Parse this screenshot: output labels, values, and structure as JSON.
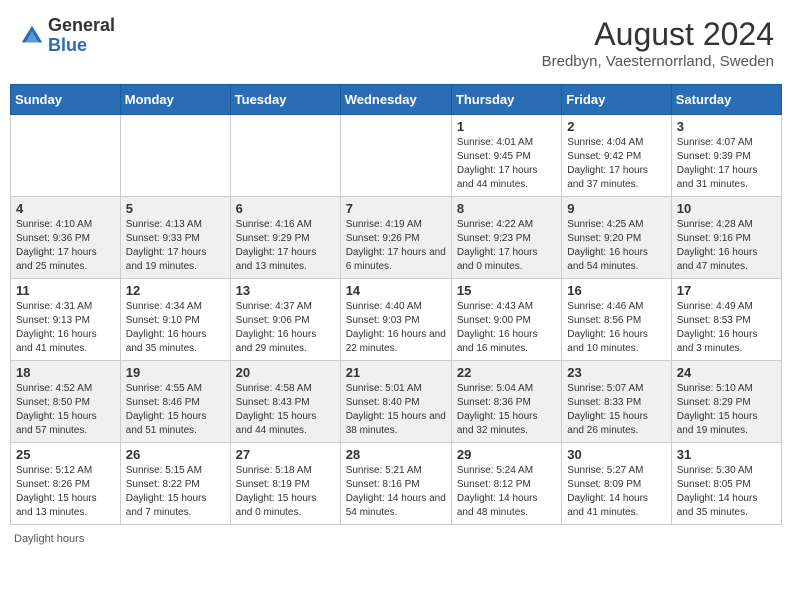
{
  "header": {
    "logo_general": "General",
    "logo_blue": "Blue",
    "month_year": "August 2024",
    "location": "Bredbyn, Vaesternorrland, Sweden"
  },
  "days_of_week": [
    "Sunday",
    "Monday",
    "Tuesday",
    "Wednesday",
    "Thursday",
    "Friday",
    "Saturday"
  ],
  "weeks": [
    [
      {
        "day": "",
        "sunrise": "",
        "sunset": "",
        "daylight": ""
      },
      {
        "day": "",
        "sunrise": "",
        "sunset": "",
        "daylight": ""
      },
      {
        "day": "",
        "sunrise": "",
        "sunset": "",
        "daylight": ""
      },
      {
        "day": "",
        "sunrise": "",
        "sunset": "",
        "daylight": ""
      },
      {
        "day": "1",
        "sunrise": "Sunrise: 4:01 AM",
        "sunset": "Sunset: 9:45 PM",
        "daylight": "Daylight: 17 hours and 44 minutes."
      },
      {
        "day": "2",
        "sunrise": "Sunrise: 4:04 AM",
        "sunset": "Sunset: 9:42 PM",
        "daylight": "Daylight: 17 hours and 37 minutes."
      },
      {
        "day": "3",
        "sunrise": "Sunrise: 4:07 AM",
        "sunset": "Sunset: 9:39 PM",
        "daylight": "Daylight: 17 hours and 31 minutes."
      }
    ],
    [
      {
        "day": "4",
        "sunrise": "Sunrise: 4:10 AM",
        "sunset": "Sunset: 9:36 PM",
        "daylight": "Daylight: 17 hours and 25 minutes."
      },
      {
        "day": "5",
        "sunrise": "Sunrise: 4:13 AM",
        "sunset": "Sunset: 9:33 PM",
        "daylight": "Daylight: 17 hours and 19 minutes."
      },
      {
        "day": "6",
        "sunrise": "Sunrise: 4:16 AM",
        "sunset": "Sunset: 9:29 PM",
        "daylight": "Daylight: 17 hours and 13 minutes."
      },
      {
        "day": "7",
        "sunrise": "Sunrise: 4:19 AM",
        "sunset": "Sunset: 9:26 PM",
        "daylight": "Daylight: 17 hours and 6 minutes."
      },
      {
        "day": "8",
        "sunrise": "Sunrise: 4:22 AM",
        "sunset": "Sunset: 9:23 PM",
        "daylight": "Daylight: 17 hours and 0 minutes."
      },
      {
        "day": "9",
        "sunrise": "Sunrise: 4:25 AM",
        "sunset": "Sunset: 9:20 PM",
        "daylight": "Daylight: 16 hours and 54 minutes."
      },
      {
        "day": "10",
        "sunrise": "Sunrise: 4:28 AM",
        "sunset": "Sunset: 9:16 PM",
        "daylight": "Daylight: 16 hours and 47 minutes."
      }
    ],
    [
      {
        "day": "11",
        "sunrise": "Sunrise: 4:31 AM",
        "sunset": "Sunset: 9:13 PM",
        "daylight": "Daylight: 16 hours and 41 minutes."
      },
      {
        "day": "12",
        "sunrise": "Sunrise: 4:34 AM",
        "sunset": "Sunset: 9:10 PM",
        "daylight": "Daylight: 16 hours and 35 minutes."
      },
      {
        "day": "13",
        "sunrise": "Sunrise: 4:37 AM",
        "sunset": "Sunset: 9:06 PM",
        "daylight": "Daylight: 16 hours and 29 minutes."
      },
      {
        "day": "14",
        "sunrise": "Sunrise: 4:40 AM",
        "sunset": "Sunset: 9:03 PM",
        "daylight": "Daylight: 16 hours and 22 minutes."
      },
      {
        "day": "15",
        "sunrise": "Sunrise: 4:43 AM",
        "sunset": "Sunset: 9:00 PM",
        "daylight": "Daylight: 16 hours and 16 minutes."
      },
      {
        "day": "16",
        "sunrise": "Sunrise: 4:46 AM",
        "sunset": "Sunset: 8:56 PM",
        "daylight": "Daylight: 16 hours and 10 minutes."
      },
      {
        "day": "17",
        "sunrise": "Sunrise: 4:49 AM",
        "sunset": "Sunset: 8:53 PM",
        "daylight": "Daylight: 16 hours and 3 minutes."
      }
    ],
    [
      {
        "day": "18",
        "sunrise": "Sunrise: 4:52 AM",
        "sunset": "Sunset: 8:50 PM",
        "daylight": "Daylight: 15 hours and 57 minutes."
      },
      {
        "day": "19",
        "sunrise": "Sunrise: 4:55 AM",
        "sunset": "Sunset: 8:46 PM",
        "daylight": "Daylight: 15 hours and 51 minutes."
      },
      {
        "day": "20",
        "sunrise": "Sunrise: 4:58 AM",
        "sunset": "Sunset: 8:43 PM",
        "daylight": "Daylight: 15 hours and 44 minutes."
      },
      {
        "day": "21",
        "sunrise": "Sunrise: 5:01 AM",
        "sunset": "Sunset: 8:40 PM",
        "daylight": "Daylight: 15 hours and 38 minutes."
      },
      {
        "day": "22",
        "sunrise": "Sunrise: 5:04 AM",
        "sunset": "Sunset: 8:36 PM",
        "daylight": "Daylight: 15 hours and 32 minutes."
      },
      {
        "day": "23",
        "sunrise": "Sunrise: 5:07 AM",
        "sunset": "Sunset: 8:33 PM",
        "daylight": "Daylight: 15 hours and 26 minutes."
      },
      {
        "day": "24",
        "sunrise": "Sunrise: 5:10 AM",
        "sunset": "Sunset: 8:29 PM",
        "daylight": "Daylight: 15 hours and 19 minutes."
      }
    ],
    [
      {
        "day": "25",
        "sunrise": "Sunrise: 5:12 AM",
        "sunset": "Sunset: 8:26 PM",
        "daylight": "Daylight: 15 hours and 13 minutes."
      },
      {
        "day": "26",
        "sunrise": "Sunrise: 5:15 AM",
        "sunset": "Sunset: 8:22 PM",
        "daylight": "Daylight: 15 hours and 7 minutes."
      },
      {
        "day": "27",
        "sunrise": "Sunrise: 5:18 AM",
        "sunset": "Sunset: 8:19 PM",
        "daylight": "Daylight: 15 hours and 0 minutes."
      },
      {
        "day": "28",
        "sunrise": "Sunrise: 5:21 AM",
        "sunset": "Sunset: 8:16 PM",
        "daylight": "Daylight: 14 hours and 54 minutes."
      },
      {
        "day": "29",
        "sunrise": "Sunrise: 5:24 AM",
        "sunset": "Sunset: 8:12 PM",
        "daylight": "Daylight: 14 hours and 48 minutes."
      },
      {
        "day": "30",
        "sunrise": "Sunrise: 5:27 AM",
        "sunset": "Sunset: 8:09 PM",
        "daylight": "Daylight: 14 hours and 41 minutes."
      },
      {
        "day": "31",
        "sunrise": "Sunrise: 5:30 AM",
        "sunset": "Sunset: 8:05 PM",
        "daylight": "Daylight: 14 hours and 35 minutes."
      }
    ]
  ],
  "footer": {
    "daylight_label": "Daylight hours"
  }
}
